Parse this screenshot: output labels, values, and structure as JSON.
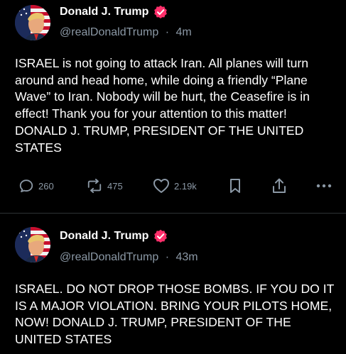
{
  "colors": {
    "background": "#000000",
    "text": "#ffffff",
    "secondary_text": "#8b98a5",
    "verified_badge": "#ff2f6b",
    "divider": "#2f3336"
  },
  "posts": [
    {
      "display_name": "Donald J. Trump",
      "handle": "@realDonaldTrump",
      "separator": "·",
      "time": "4m",
      "text": "ISRAEL is not going to attack Iran. All planes will turn around and head home, while doing a friendly “Plane Wave” to Iran. Nobody will be hurt, the Ceasefire is in effect! Thank you for your attention to this matter! DONALD J. TRUMP, PRESIDENT OF THE UNITED STATES",
      "actions": {
        "reply_icon": "comment-icon",
        "reply_count": "260",
        "repost_icon": "repost-icon",
        "repost_count": "475",
        "like_icon": "heart-icon",
        "like_count": "2.19k",
        "bookmark_icon": "bookmark-icon",
        "share_icon": "share-icon",
        "more_icon": "more-icon"
      }
    },
    {
      "display_name": "Donald J. Trump",
      "handle": "@realDonaldTrump",
      "separator": "·",
      "time": "43m",
      "text": "ISRAEL. DO NOT DROP THOSE BOMBS. IF YOU DO IT IS A MAJOR VIOLATION. BRING YOUR PILOTS HOME, NOW!  DONALD J. TRUMP, PRESIDENT OF THE UNITED STATES"
    }
  ]
}
